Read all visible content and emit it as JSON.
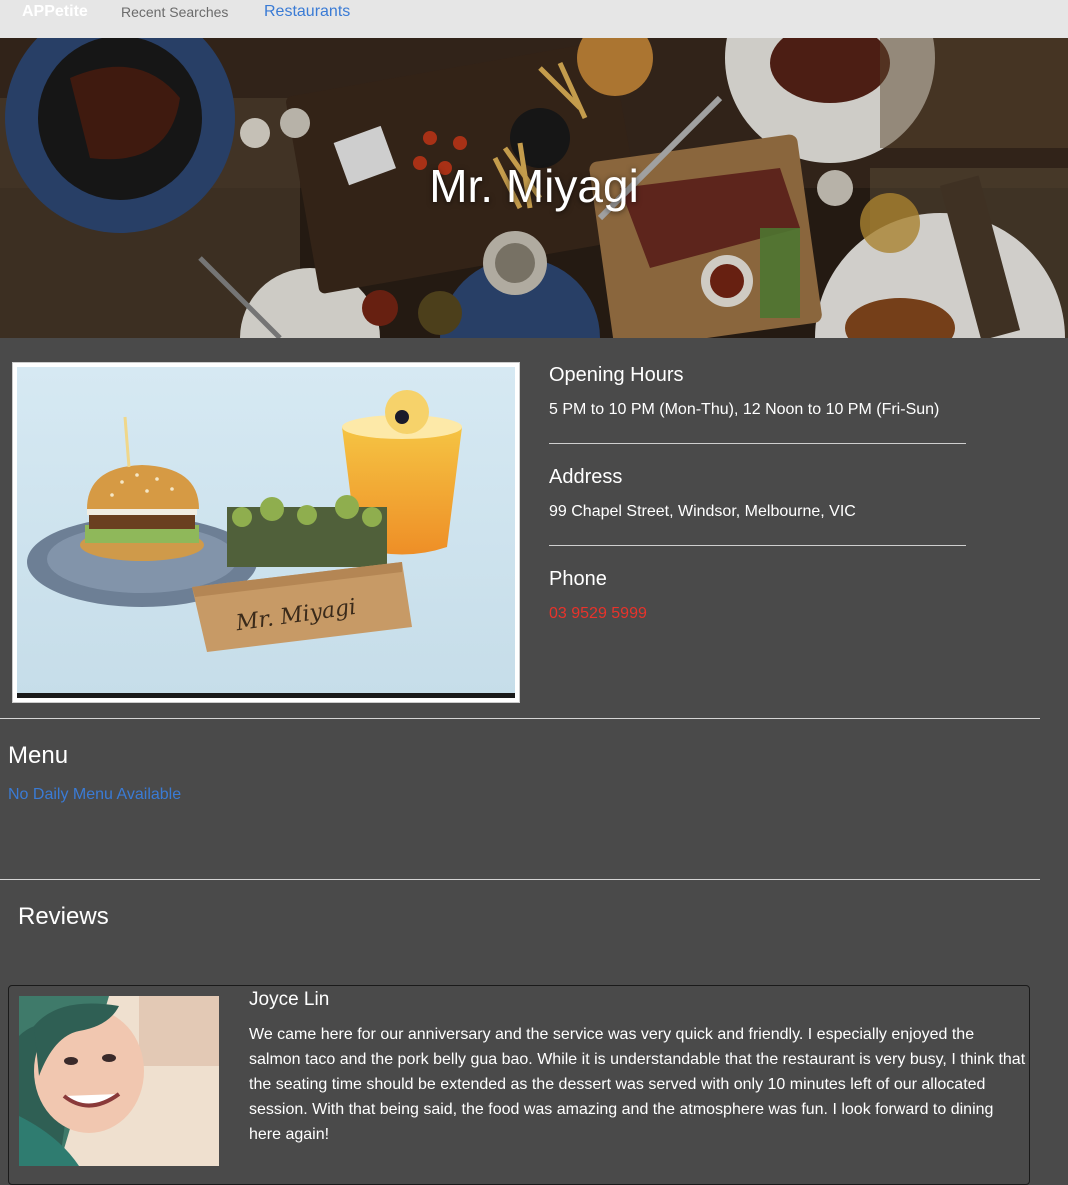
{
  "nav": {
    "brand": "APPetite",
    "recent_searches": "Recent Searches",
    "restaurants": "Restaurants"
  },
  "hero": {
    "title": "Mr. Miyagi"
  },
  "photo": {
    "box_text": "Mr. Miyagi"
  },
  "info": {
    "hours_heading": "Opening Hours",
    "hours": "5 PM to 10 PM (Mon-Thu), 12 Noon to 10 PM (Fri-Sun)",
    "address_heading": "Address",
    "address": "99 Chapel Street, Windsor, Melbourne, VIC",
    "phone_heading": "Phone",
    "phone": "03 9529 5999"
  },
  "menu": {
    "heading": "Menu",
    "status": "No Daily Menu Available"
  },
  "reviews": {
    "heading": "Reviews",
    "items": [
      {
        "name": "Joyce Lin",
        "text": "We came here for our anniversary and the service was very quick and friendly. I especially enjoyed the salmon taco and the pork belly gua bao. While it is understandable that the restaurant is very busy, I think that the seating time should be extended as the dessert was served with only 10 minutes left of our allocated session. With that being said, the food was amazing and the atmosphere was fun. I look forward to dining here again!"
      }
    ]
  },
  "colors": {
    "page_bg": "#4a4a4a",
    "navbar_bg": "#e6e6e6",
    "link_blue": "#3a7bd5",
    "phone_red": "#e8332b"
  }
}
